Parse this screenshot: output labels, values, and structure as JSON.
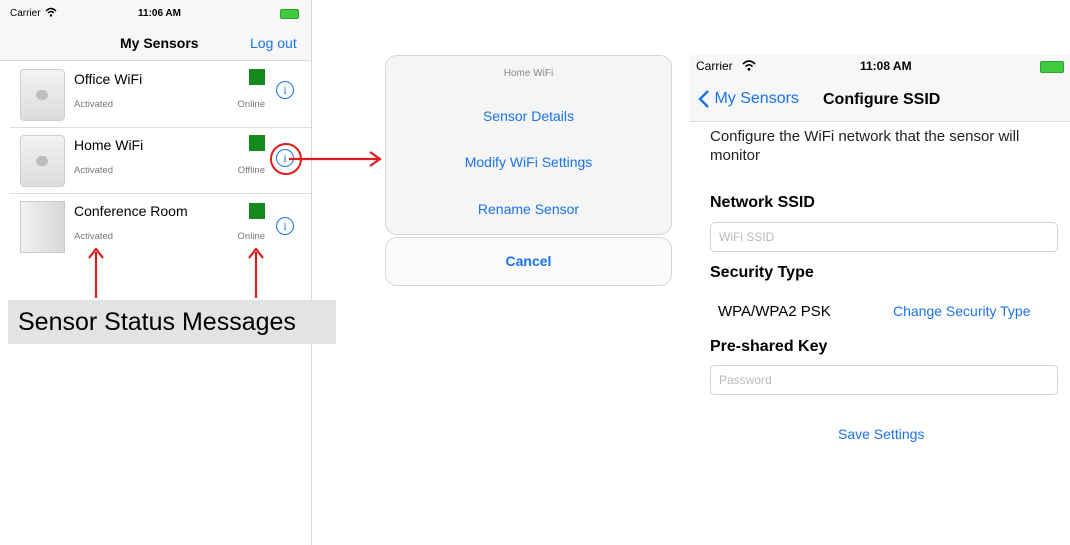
{
  "left_screen": {
    "status": {
      "carrier": "Carrier",
      "time": "11:06 AM"
    },
    "title": "My Sensors",
    "logout": "Log out",
    "sensors": [
      {
        "name": "Office WiFi",
        "status": "Activated",
        "connection": "Online"
      },
      {
        "name": "Home WiFi",
        "status": "Activated",
        "connection": "Offline"
      },
      {
        "name": "Conference Room",
        "status": "Activated",
        "connection": "Online"
      }
    ],
    "annotation": "Sensor Status Messages"
  },
  "action_sheet": {
    "title": "Home WiFi",
    "options": [
      "Sensor Details",
      "Modify WiFi Settings",
      "Rename Sensor"
    ],
    "cancel": "Cancel"
  },
  "right_screen": {
    "status": {
      "carrier": "Carrier",
      "time": "11:08 AM"
    },
    "back": "My Sensors",
    "title": "Configure SSID",
    "description": "Configure the WiFi network that the sensor will monitor",
    "network_ssid_label": "Network SSID",
    "ssid_placeholder": "WiFi SSID",
    "security_type_label": "Security Type",
    "security_type_value": "WPA/WPA2 PSK",
    "change_security": "Change Security Type",
    "psk_label": "Pre-shared Key",
    "password_placeholder": "Password",
    "save": "Save Settings"
  },
  "colors": {
    "accent": "#1a73e8",
    "status_square": "#148a1c",
    "annotation_red": "#e01b1b"
  },
  "icons": [
    "wifi-icon",
    "battery-icon",
    "info-icon",
    "chevron-left-icon",
    "arrow-icon"
  ]
}
